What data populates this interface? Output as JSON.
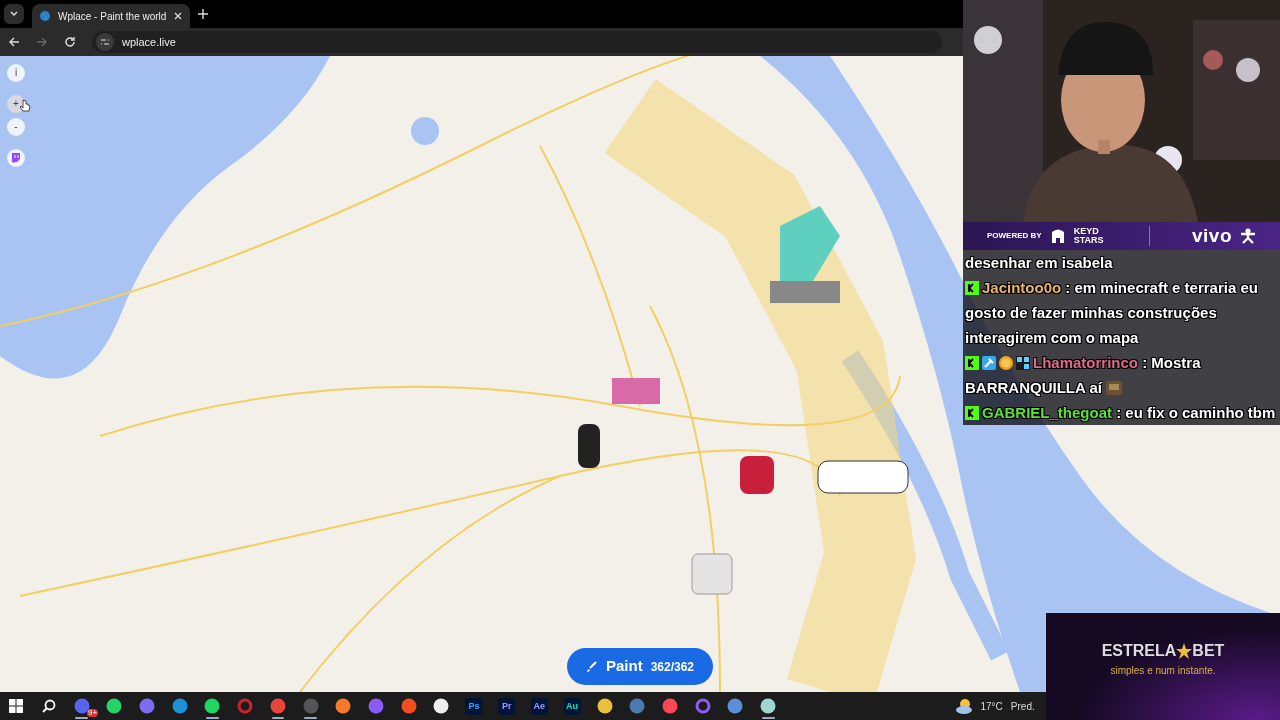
{
  "browser": {
    "tabs": [
      {
        "title": "Wplace - Paint the world",
        "selected": true
      }
    ],
    "address": "wplace.live",
    "forward_disabled": true
  },
  "map": {
    "kind": "picture",
    "controls": [
      {
        "kind": "text",
        "label": "i",
        "hovered": false
      },
      {
        "kind": "text",
        "label": "+",
        "hovered": true
      },
      {
        "kind": "text",
        "label": "-",
        "hovered": false
      },
      {
        "kind": "twitch",
        "hovered": false
      }
    ],
    "paint_button": {
      "label": "Paint",
      "count": "362/362"
    }
  },
  "sponsor_bar": {
    "powered_by": "POWERED BY",
    "sponsor": "KEYD STARS",
    "partner": "vivo"
  },
  "chat": [
    {
      "lines": [
        "desenhar em isabela"
      ]
    },
    {
      "badges": [
        {
          "kind": "kick"
        }
      ],
      "user": "Jacintoo0o",
      "color": "#e8b66a",
      "lines": [
        ": em minecraft e terraria eu",
        "gosto de fazer minhas construções",
        "interagirem com o mapa"
      ]
    },
    {
      "badges": [
        {
          "kind": "kick"
        },
        {
          "kind": "hammer"
        },
        {
          "kind": "coin"
        },
        {
          "kind": "grid"
        }
      ],
      "user": "Lhamatorrinco",
      "color": "#e06a8c",
      "lines": [
        ": Mostra",
        "BARRANQUILLA aí"
      ],
      "emote": true
    },
    {
      "badges": [
        {
          "kind": "kick"
        }
      ],
      "user": "GABRIEL_thegoat",
      "color": "#5ee03a",
      "lines": [
        ": eu fix o caminho tbm"
      ]
    }
  ],
  "ad": {
    "brand": "ESTRELA",
    "brand_end": "BET",
    "tagline": "simples e num instante."
  },
  "taskbar": {
    "apps": [
      {
        "kind": "windows",
        "running": false
      },
      {
        "kind": "search",
        "running": false
      },
      {
        "kind": "app",
        "color": "#5865f2",
        "badge": "9+",
        "running": true
      },
      {
        "kind": "app",
        "color": "#25d366",
        "running": false
      },
      {
        "kind": "app",
        "color": "#7b6cf0",
        "running": false
      },
      {
        "kind": "app",
        "color": "#1e90d8",
        "running": false
      },
      {
        "kind": "app",
        "color": "#1ed760",
        "running": true
      },
      {
        "kind": "ring",
        "color": "#d3202e",
        "running": false
      },
      {
        "kind": "app",
        "color": "#e8453c",
        "running": true
      },
      {
        "kind": "app",
        "color": "#555555",
        "running": true
      },
      {
        "kind": "app",
        "color": "#f5792a",
        "running": false
      },
      {
        "kind": "app",
        "color": "#8a5cf5",
        "running": false
      },
      {
        "kind": "app",
        "color": "#f24e1e",
        "running": false
      },
      {
        "kind": "app",
        "color": "#eeeeee",
        "running": false
      },
      {
        "kind": "label",
        "label": "Ps",
        "color": "#31a8ff",
        "running": false
      },
      {
        "kind": "label",
        "label": "Pr",
        "color": "#9999ff",
        "running": false
      },
      {
        "kind": "label",
        "label": "Ae",
        "color": "#9999ff",
        "running": false
      },
      {
        "kind": "label",
        "label": "Au",
        "color": "#00e4bb",
        "running": false
      },
      {
        "kind": "app",
        "color": "#e8c040",
        "running": false
      },
      {
        "kind": "app",
        "color": "#4a7ab0",
        "running": false
      },
      {
        "kind": "app",
        "color": "#ff4655",
        "running": false
      },
      {
        "kind": "ring",
        "color": "#8d5cf6",
        "running": false
      },
      {
        "kind": "app",
        "color": "#5a8fd8",
        "running": false
      },
      {
        "kind": "app",
        "color": "#9fd8d0",
        "running": true
      }
    ],
    "weather": {
      "temperature": "17°C",
      "text": "Pred."
    }
  }
}
